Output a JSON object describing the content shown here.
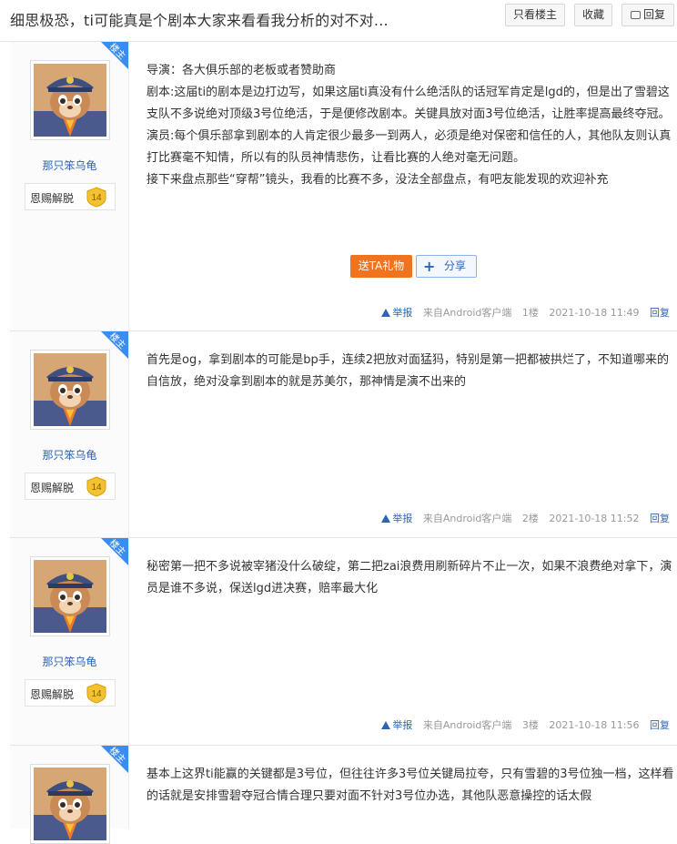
{
  "thread": {
    "title": "细思极恐，ti可能真是个剧本大家来看看我分析的对不对...",
    "only_author_label": "只看楼主",
    "favorite_label": "收藏",
    "reply_label": "回复"
  },
  "colors": {
    "accent": "#3b8cf0",
    "link": "#2d64b3",
    "gift": "#f0731f"
  },
  "posts": [
    {
      "badge_corner": "楼主",
      "author": "那只笨乌龟",
      "honor_name": "恩赐解脱",
      "level": "14",
      "paragraphs": [
        "导演：各大俱乐部的老板或者赞助商",
        "剧本:这届ti的剧本是边打边写，如果这届ti真没有什么绝活队的话冠军肯定是lgd的，但是出了雪碧这支队不多说绝对顶级3号位绝活，于是便修改剧本。关键具放对面3号位绝活，让胜率提高最终夺冠。",
        "演员:每个俱乐部拿到剧本的人肯定很少最多一到两人，必须是绝对保密和信任的人，其他队友则认真打比赛毫不知情，所以有的队员神情悲伤，让看比赛的人绝对毫无问题。",
        "接下来盘点那些“穿帮”镜头，我看的比赛不多，没法全部盘点，有吧友能发现的欢迎补充"
      ],
      "gift_label": "送TA礼物",
      "share_label": "分享",
      "report": "举报",
      "source": "来自Android客户端",
      "floor": "1楼",
      "time": "2021-10-18 11:49",
      "reply": "回复"
    },
    {
      "badge_corner": "楼主",
      "author": "那只笨乌龟",
      "honor_name": "恩赐解脱",
      "level": "14",
      "paragraphs": [
        "首先是og，拿到剧本的可能是bp手，连续2把放对面猛犸，特别是第一把都被拱烂了，不知道哪来的自信放，绝对没拿到剧本的就是苏美尔，那神情是演不出来的"
      ],
      "report": "举报",
      "source": "来自Android客户端",
      "floor": "2楼",
      "time": "2021-10-18 11:52",
      "reply": "回复"
    },
    {
      "badge_corner": "楼主",
      "author": "那只笨乌龟",
      "honor_name": "恩赐解脱",
      "level": "14",
      "paragraphs": [
        "秘密第一把不多说被宰猪没什么破绽，第二把zai浪费用刷新碎片不止一次，如果不浪费绝对拿下，演员是谁不多说，保送lgd进决赛，赔率最大化"
      ],
      "report": "举报",
      "source": "来自Android客户端",
      "floor": "3楼",
      "time": "2021-10-18 11:56",
      "reply": "回复"
    },
    {
      "badge_corner": "楼主",
      "paragraphs": [
        "基本上这界ti能赢的关键都是3号位，但往往许多3号位关键局拉夸，只有雪碧的3号位独一档，这样看的话就是安排雪碧夺冠合情合理只要对面不针对3号位办选，其他队恶意操控的话太假"
      ]
    }
  ]
}
